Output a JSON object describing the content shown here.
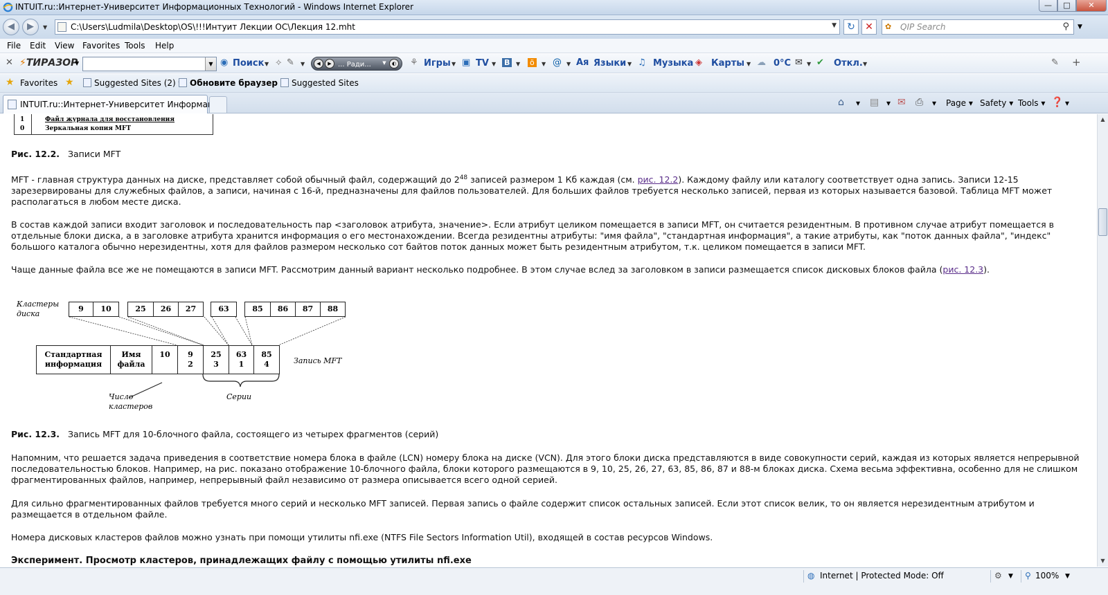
{
  "window": {
    "title": "INTUIT.ru::Интернет-Университет Информационных Технологий - Windows Internet Explorer",
    "minimize": "—",
    "maximize": "□",
    "close": "✕"
  },
  "address": {
    "url": "C:\\Users\\Ludmila\\Desktop\\OS\\!!!Интуит Лекции ОС\\Лекция 12.mht",
    "search_placeholder": "QIP Search"
  },
  "menu": [
    "File",
    "Edit",
    "View",
    "Favorites",
    "Tools",
    "Help"
  ],
  "toolbar": {
    "logo": "ТИРАЗОР",
    "search": "Поиск",
    "radio": "... Ради...",
    "games": "Игры",
    "tv": "TV",
    "languages": "Языки",
    "music": "Музыка",
    "maps": "Карты",
    "weather": "0°C",
    "off": "Откл."
  },
  "favorites": {
    "favorites": "Favorites",
    "suggested1": "Suggested Sites (2)",
    "update": "Обновите браузер",
    "suggested2": "Suggested Sites"
  },
  "tab": {
    "title": "INTUIT.ru::Интернет-Университет Информаци..."
  },
  "commandbar": {
    "page": "Page",
    "safety": "Safety",
    "tools": "Tools"
  },
  "content": {
    "fig2_rows": [
      {
        "n": "1",
        "label": "Файл журнала для восстановления"
      },
      {
        "n": "0",
        "label": "Зеркальная копия MFT"
      }
    ],
    "fig2_caption_bold": "Рис. 12.2.",
    "fig2_caption": "Записи MFT",
    "p1_a": "MFT - главная структура данных на диске, представляет собой обычный файл, содержащий до 2",
    "p1_sup": "48",
    "p1_b": " записей размером 1 Кб каждая (см. ",
    "p1_link": "рис. 12.2",
    "p1_c": "). Каждому файлу или каталогу соответствует одна запись. Записи 12-15 зарезервированы для служебных файлов, а записи, начиная с 16-й, предназначены для файлов пользователей. Для больших файлов требуется несколько записей, первая из которых называется базовой. Таблица MFT может располагаться в любом месте диска.",
    "p2": "В состав каждой записи входит заголовок и последовательность пар <заголовок атрибута, значение>. Если атрибут целиком помещается в записи MFT, он считается резидентным. В противном случае атрибут помещается в отдельные блоки диска, а в заголовке атрибута хранится информация о его местонахождении. Всегда резидентны атрибуты: \"имя файла\", \"стандартная информация\", а такие атрибуты, как \"поток данных файла\", \"индекс\" большого каталога обычно нерезидентны, хотя для файлов размером несколько сот байтов поток данных может быть резидентным атрибутом, т.к. целиком помещается в записи MFT.",
    "p3_a": "Чаще данные файла все же не помещаются в записи MFT. Рассмотрим данный вариант несколько подробнее. В этом случае вслед за заголовком в записи размещается список дисковых блоков файла (",
    "p3_link": "рис. 12.3",
    "p3_b": ").",
    "fig3": {
      "disk_label_1": "Кластеры",
      "disk_label_2": "диска",
      "clusters": [
        "9",
        "10",
        "25",
        "26",
        "27",
        "63",
        "85",
        "86",
        "87",
        "88"
      ],
      "rec_std_1": "Стандартная",
      "rec_std_2": "информация",
      "rec_name_1": "Имя",
      "rec_name_2": "файла",
      "rec_count": "10",
      "runs": [
        {
          "start": "9",
          "len": "2"
        },
        {
          "start": "25",
          "len": "3"
        },
        {
          "start": "63",
          "len": "1"
        },
        {
          "start": "85",
          "len": "4"
        }
      ],
      "mft_label": "Запись MFT",
      "count_label_1": "Число",
      "count_label_2": "кластеров",
      "series_label": "Серии"
    },
    "fig3_caption_bold": "Рис. 12.3.",
    "fig3_caption": "Запись MFT для 10-блочного файла, состоящего из четырех фрагментов (серий)",
    "p4": "Напомним, что решается задача приведения в соответствие номера блока в файле (LCN) номеру блока на диске (VCN). Для этого блоки диска представляются в виде совокупности серий, каждая из которых является непрерывной последовательностью блоков. Например, на рис. показано отображение 10-блочного файла, блоки которого размещаются в 9, 10, 25, 26, 27, 63, 85, 86, 87 и 88-м блоках диска. Схема весьма эффективна, особенно для не слишком фрагментированных файлов, например, непрерывный файл независимо от размера описывается всего одной серией.",
    "p5": "Для сильно фрагментированных файлов требуется много серий и несколько MFT записей. Первая запись о файле содержит список остальных записей. Если этот список велик, то он является нерезидентным атрибутом и размещается в отдельном файле.",
    "p6": "Номера дисковых кластеров файлов можно узнать при помощи утилиты nfi.exe (NTFS File Sectors Information Util), входящей в состав ресурсов Windows.",
    "h_experiment": "Эксперимент. Просмотр кластеров, принадлежащих файлу с помощью утилиты nfi.exe"
  },
  "status": {
    "zone": "Internet | Protected Mode: Off",
    "zoom": "100%"
  }
}
